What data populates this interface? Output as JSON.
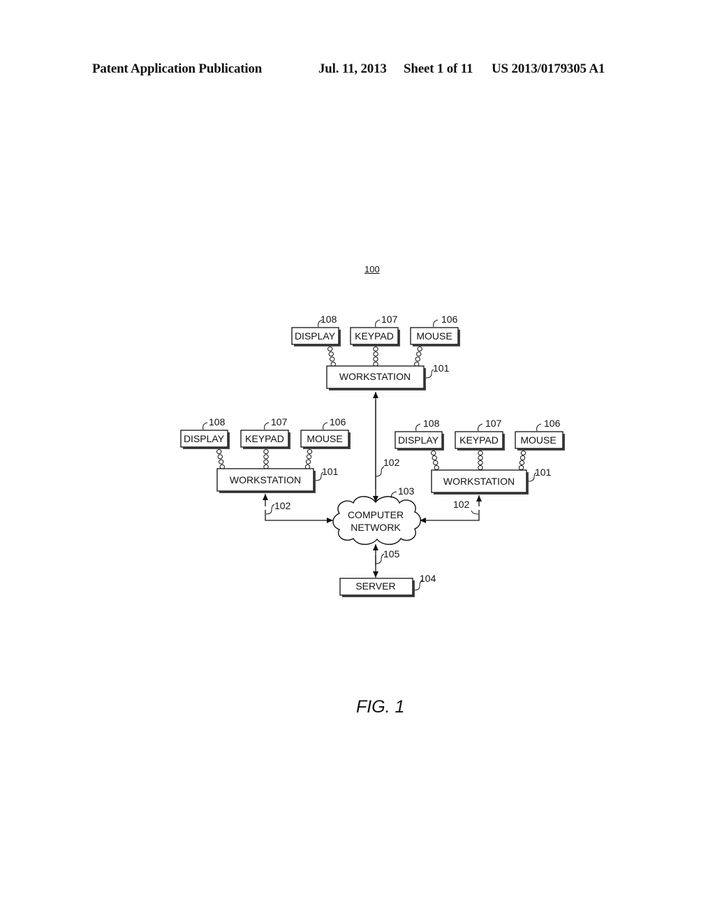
{
  "header": {
    "left": "Patent Application Publication",
    "date": "Jul. 11, 2013",
    "sheet": "Sheet 1 of 11",
    "number": "US 2013/0179305 A1"
  },
  "figure": {
    "ref": "100",
    "caption": "FIG. 1"
  },
  "workstations": [
    {
      "id": "top",
      "label": "WORKSTATION",
      "ref": "101",
      "link_ref": "102",
      "peripherals": [
        {
          "label": "DISPLAY",
          "ref": "108"
        },
        {
          "label": "KEYPAD",
          "ref": "107"
        },
        {
          "label": "MOUSE",
          "ref": "106"
        }
      ]
    },
    {
      "id": "left",
      "label": "WORKSTATION",
      "ref": "101",
      "link_ref": "102",
      "peripherals": [
        {
          "label": "DISPLAY",
          "ref": "108"
        },
        {
          "label": "KEYPAD",
          "ref": "107"
        },
        {
          "label": "MOUSE",
          "ref": "106"
        }
      ]
    },
    {
      "id": "right",
      "label": "WORKSTATION",
      "ref": "101",
      "link_ref": "102",
      "peripherals": [
        {
          "label": "DISPLAY",
          "ref": "108"
        },
        {
          "label": "KEYPAD",
          "ref": "107"
        },
        {
          "label": "MOUSE",
          "ref": "106"
        }
      ]
    }
  ],
  "network": {
    "line1": "COMPUTER",
    "line2": "NETWORK",
    "ref": "103"
  },
  "server": {
    "label": "SERVER",
    "ref": "104",
    "link_ref": "105"
  }
}
